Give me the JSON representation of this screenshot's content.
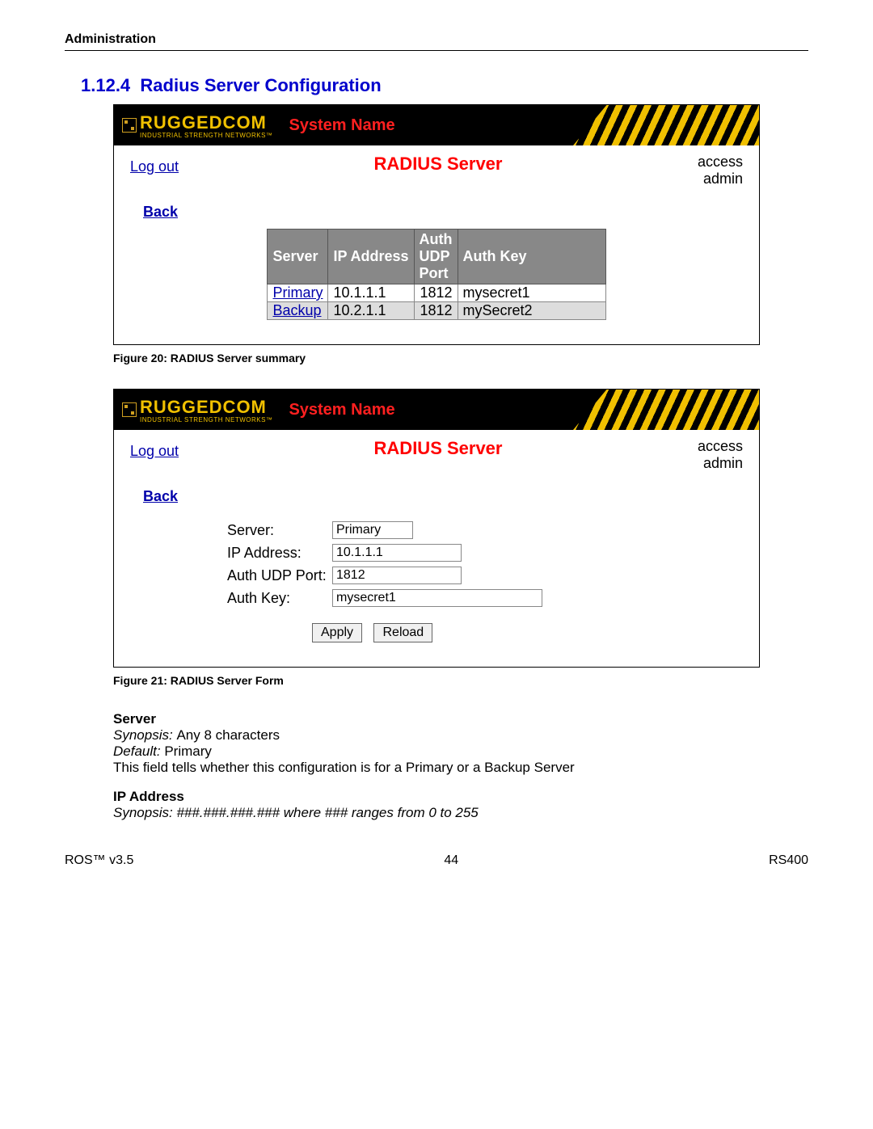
{
  "page_header": "Administration",
  "section_number": "1.12.4",
  "section_title": "Radius Server Configuration",
  "figure1": {
    "logo_main": "RUGGEDCOM",
    "logo_sub": "INDUSTRIAL STRENGTH NETWORKS™",
    "system_name": "System Name",
    "logout": "Log out",
    "title": "RADIUS Server",
    "access1": "access",
    "access2": "admin",
    "back": "Back",
    "headers": [
      "Server",
      "IP Address",
      "Auth UDP Port",
      "Auth Key"
    ],
    "rows": [
      {
        "server": "Primary",
        "ip": "10.1.1.1",
        "port": "1812",
        "key": "mysecret1"
      },
      {
        "server": "Backup",
        "ip": "10.2.1.1",
        "port": "1812",
        "key": "mySecret2"
      }
    ],
    "caption": "Figure 20: RADIUS Server summary"
  },
  "figure2": {
    "logo_main": "RUGGEDCOM",
    "logo_sub": "INDUSTRIAL STRENGTH NETWORKS™",
    "system_name": "System Name",
    "logout": "Log out",
    "title": "RADIUS Server",
    "access1": "access",
    "access2": "admin",
    "back": "Back",
    "form": {
      "server_label": "Server:",
      "server_value": "Primary",
      "ip_label": "IP Address:",
      "ip_value": "10.1.1.1",
      "port_label": "Auth UDP Port:",
      "port_value": "1812",
      "key_label": "Auth Key:",
      "key_value": "mysecret1"
    },
    "apply": "Apply",
    "reload": "Reload",
    "caption": "Figure 21: RADIUS Server Form"
  },
  "doc": {
    "server_heading": "Server",
    "server_syn": "Synopsis: ",
    "server_syn_val": "Any 8 characters",
    "server_def": "Default: ",
    "server_def_val": "Primary",
    "server_desc": "This field tells whether this configuration is for a Primary or a Backup Server",
    "ip_heading": "IP Address",
    "ip_syn": "Synopsis: ",
    "ip_syn_val": "###.###.###.###  where ### ranges from 0 to 255"
  },
  "footer": {
    "left": "ROS™  v3.5",
    "center": "44",
    "right": "RS400"
  }
}
